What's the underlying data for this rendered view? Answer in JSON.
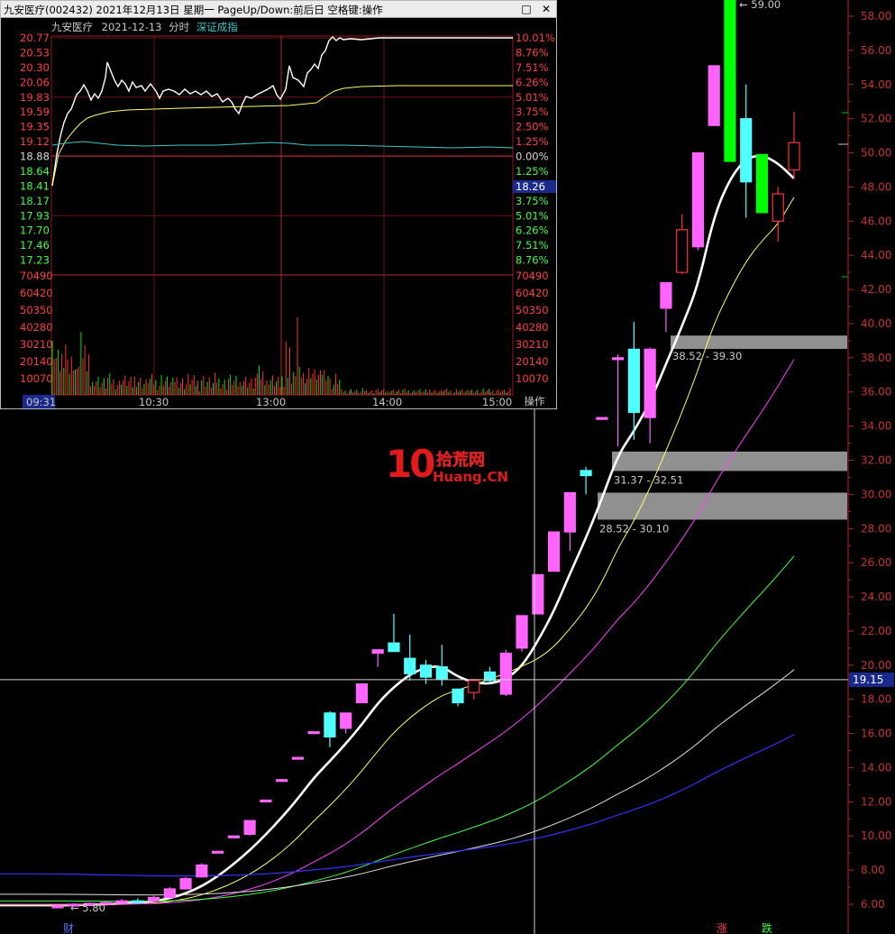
{
  "popup": {
    "title": "九安医疗(002432) 2021年12月13日 星期一 PageUp/Down:前后日 空格键:操作",
    "stock_name": "九安医疗",
    "date": "2021-12-13",
    "mode": "分时",
    "index_label": "深证成指",
    "price_ticks": [
      "20.77",
      "20.53",
      "20.30",
      "20.06",
      "19.83",
      "19.59",
      "19.35",
      "19.12",
      "18.88",
      "18.64",
      "18.41",
      "18.17",
      "17.93",
      "17.70",
      "17.46",
      "17.23"
    ],
    "pct_ticks": [
      "10.01%",
      "8.76%",
      "7.51%",
      "6.26%",
      "5.01%",
      "3.75%",
      "2.50%",
      "1.25%",
      "0.00%",
      "1.25%",
      "2.50%",
      "3.75%",
      "5.01%",
      "6.26%",
      "7.51%",
      "8.76%"
    ],
    "current_price_tag": "18.26",
    "volume_ticks": [
      "70490",
      "60420",
      "50350",
      "40280",
      "30210",
      "20140",
      "10070"
    ],
    "time_ticks": [
      "09:31",
      "10:30",
      "13:00",
      "14:00",
      "15:00"
    ],
    "ops_button": "操作",
    "colors": {
      "up": "#ff3232",
      "down": "#00e600",
      "price_line": "#ffffff",
      "avg_line": "#ffff64",
      "index_line": "#3cc8c8"
    }
  },
  "main_chart": {
    "y_ticks": [
      "58.00",
      "56.00",
      "54.00",
      "52.00",
      "50.00",
      "48.00",
      "46.00",
      "44.00",
      "42.00",
      "40.00",
      "38.00",
      "36.00",
      "34.00",
      "32.00",
      "30.00",
      "28.00",
      "26.00",
      "24.00",
      "22.00",
      "20.00",
      "18.00",
      "16.00",
      "14.00",
      "12.00",
      "10.00",
      "8.00",
      "6.00"
    ],
    "crosshair_price_tag": "19.15",
    "gap_zones": [
      "38.52 - 39.30",
      "31.37 - 32.51",
      "28.52 - 30.10"
    ],
    "high_label": "59.00",
    "low_label": "5.80",
    "bottom_markers": [
      "财",
      "涨",
      "跌"
    ],
    "watermark": {
      "brand": "10",
      "cn": "拾荒网",
      "en": "Huang.CN"
    },
    "colors": {
      "up": "#ff64ff",
      "down": "#50ffff",
      "limit_up": "#ff3232",
      "big_green": "#00ff00",
      "gap_zone": "#909090"
    }
  },
  "chart_data": {
    "type": "candlestick",
    "ylim": [
      5.5,
      59.5
    ],
    "candles": [
      {
        "o": 5.9,
        "h": 6.0,
        "l": 5.8,
        "c": 5.9
      },
      {
        "o": 5.95,
        "h": 6.05,
        "l": 5.9,
        "c": 6.0
      },
      {
        "o": 6.0,
        "h": 6.1,
        "l": 5.95,
        "c": 6.05
      },
      {
        "o": 6.05,
        "h": 6.15,
        "l": 6.0,
        "c": 6.1
      },
      {
        "o": 6.1,
        "h": 6.3,
        "l": 6.05,
        "c": 6.2
      },
      {
        "o": 6.2,
        "h": 6.35,
        "l": 6.1,
        "c": 6.15
      },
      {
        "o": 6.2,
        "h": 6.5,
        "l": 6.15,
        "c": 6.4
      },
      {
        "o": 6.4,
        "h": 7.0,
        "l": 6.35,
        "c": 6.9
      },
      {
        "o": 6.9,
        "h": 7.6,
        "l": 6.85,
        "c": 7.5
      },
      {
        "o": 7.6,
        "h": 8.4,
        "l": 7.55,
        "c": 8.3
      },
      {
        "o": 9.1,
        "h": 9.1,
        "l": 9.1,
        "c": 9.1
      },
      {
        "o": 10.0,
        "h": 10.0,
        "l": 10.0,
        "c": 10.0
      },
      {
        "o": 10.1,
        "h": 10.9,
        "l": 10.0,
        "c": 10.9
      },
      {
        "o": 12.1,
        "h": 12.1,
        "l": 12.1,
        "c": 12.1
      },
      {
        "o": 13.3,
        "h": 13.3,
        "l": 13.3,
        "c": 13.3
      },
      {
        "o": 14.6,
        "h": 14.6,
        "l": 14.6,
        "c": 14.6
      },
      {
        "o": 16.1,
        "h": 16.1,
        "l": 16.1,
        "c": 16.1
      },
      {
        "o": 17.2,
        "h": 17.3,
        "l": 15.2,
        "c": 15.8
      },
      {
        "o": 16.3,
        "h": 17.2,
        "l": 16.0,
        "c": 17.2
      },
      {
        "o": 17.8,
        "h": 18.9,
        "l": 17.8,
        "c": 18.9
      },
      {
        "o": 20.7,
        "h": 20.9,
        "l": 19.9,
        "c": 20.9
      },
      {
        "o": 21.3,
        "h": 23.0,
        "l": 20.8,
        "c": 20.8
      },
      {
        "o": 20.4,
        "h": 21.8,
        "l": 19.1,
        "c": 19.5
      },
      {
        "o": 20.0,
        "h": 20.3,
        "l": 18.9,
        "c": 19.3
      },
      {
        "o": 19.9,
        "h": 21.2,
        "l": 18.8,
        "c": 19.2
      },
      {
        "o": 18.6,
        "h": 18.6,
        "l": 17.6,
        "c": 17.8
      },
      {
        "o": 18.4,
        "h": 19.2,
        "l": 18.0,
        "c": 19.1
      },
      {
        "o": 19.6,
        "h": 19.9,
        "l": 18.9,
        "c": 19.1
      },
      {
        "o": 18.3,
        "h": 20.9,
        "l": 18.2,
        "c": 20.7
      },
      {
        "o": 21.0,
        "h": 22.9,
        "l": 20.8,
        "c": 22.9
      },
      {
        "o": 23.0,
        "h": 25.3,
        "l": 23.0,
        "c": 25.3
      },
      {
        "o": 25.5,
        "h": 27.8,
        "l": 25.5,
        "c": 27.8
      },
      {
        "o": 27.8,
        "h": 30.1,
        "l": 26.7,
        "c": 30.1
      },
      {
        "o": 31.4,
        "h": 31.6,
        "l": 30.0,
        "c": 31.1
      },
      {
        "o": 34.5,
        "h": 34.5,
        "l": 34.5,
        "c": 34.5
      },
      {
        "o": 38.0,
        "h": 38.2,
        "l": 32.8,
        "c": 38.0
      },
      {
        "o": 38.5,
        "h": 40.1,
        "l": 33.2,
        "c": 34.8
      },
      {
        "o": 34.5,
        "h": 38.6,
        "l": 33.0,
        "c": 38.5
      },
      {
        "o": 40.9,
        "h": 42.4,
        "l": 39.5,
        "c": 42.4
      },
      {
        "o": 43.0,
        "h": 46.4,
        "l": 42.9,
        "c": 45.5
      },
      {
        "o": 44.5,
        "h": 50.0,
        "l": 44.3,
        "c": 50.0
      },
      {
        "o": 51.6,
        "h": 55.1,
        "l": 51.6,
        "c": 55.1
      },
      {
        "o": 59.0,
        "h": 59.0,
        "l": 49.5,
        "c": 49.5
      },
      {
        "o": 52.0,
        "h": 54.0,
        "l": 46.2,
        "c": 48.3
      },
      {
        "o": 49.9,
        "h": 49.9,
        "l": 46.5,
        "c": 46.5
      },
      {
        "o": 46.0,
        "h": 48.0,
        "l": 44.8,
        "c": 47.6
      },
      {
        "o": 49.0,
        "h": 52.4,
        "l": 48.5,
        "c": 50.6
      }
    ]
  }
}
